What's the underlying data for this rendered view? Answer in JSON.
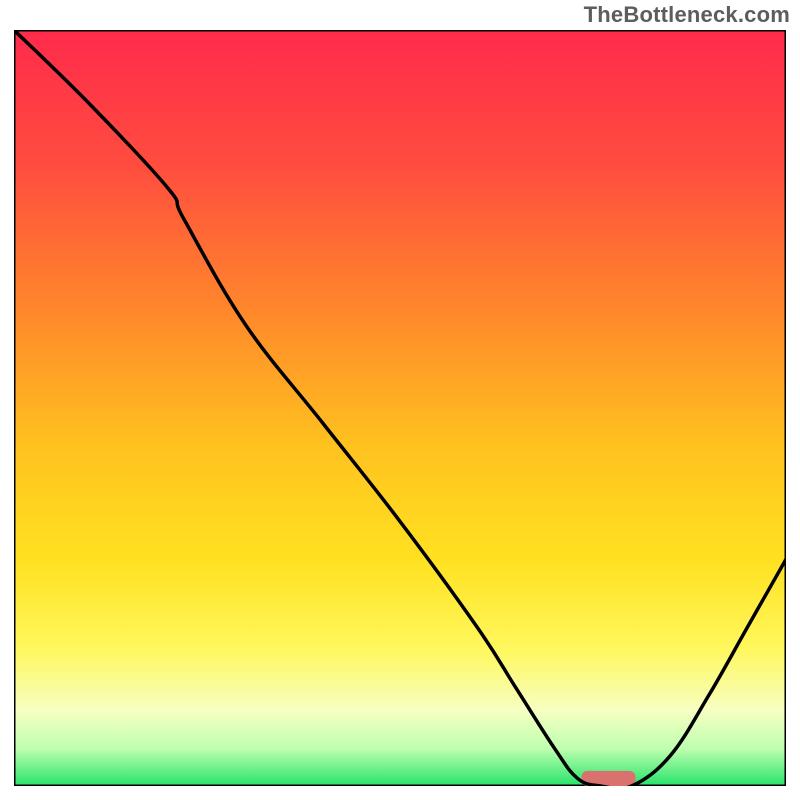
{
  "watermark": "TheBottleneck.com",
  "chart_data": {
    "type": "line",
    "title": "",
    "xlabel": "",
    "ylabel": "",
    "xlim": [
      0,
      100
    ],
    "ylim": [
      0,
      100
    ],
    "grid": false,
    "legend": false,
    "gradient_stops": [
      {
        "offset": 0.0,
        "color": "#ff2a4b"
      },
      {
        "offset": 0.18,
        "color": "#ff4d3f"
      },
      {
        "offset": 0.38,
        "color": "#ff8a2a"
      },
      {
        "offset": 0.55,
        "color": "#ffc21f"
      },
      {
        "offset": 0.7,
        "color": "#ffe120"
      },
      {
        "offset": 0.82,
        "color": "#fff85e"
      },
      {
        "offset": 0.9,
        "color": "#f6ffc2"
      },
      {
        "offset": 0.95,
        "color": "#bfffb0"
      },
      {
        "offset": 1.0,
        "color": "#26e36a"
      }
    ],
    "series": [
      {
        "name": "bottleneck-curve",
        "color": "#000000",
        "x": [
          0,
          10,
          20,
          22,
          30,
          40,
          50,
          60,
          65,
          70,
          73,
          76,
          80,
          85,
          90,
          95,
          100
        ],
        "y": [
          100,
          90,
          79,
          75,
          61,
          48,
          35,
          21,
          13,
          5,
          1,
          0,
          0,
          4,
          12,
          21,
          30
        ]
      }
    ],
    "markers": [
      {
        "name": "optimal-marker",
        "shape": "rounded-rect",
        "color": "#d9716e",
        "cx": 77,
        "cy": 1,
        "w": 7,
        "h": 2
      }
    ]
  }
}
